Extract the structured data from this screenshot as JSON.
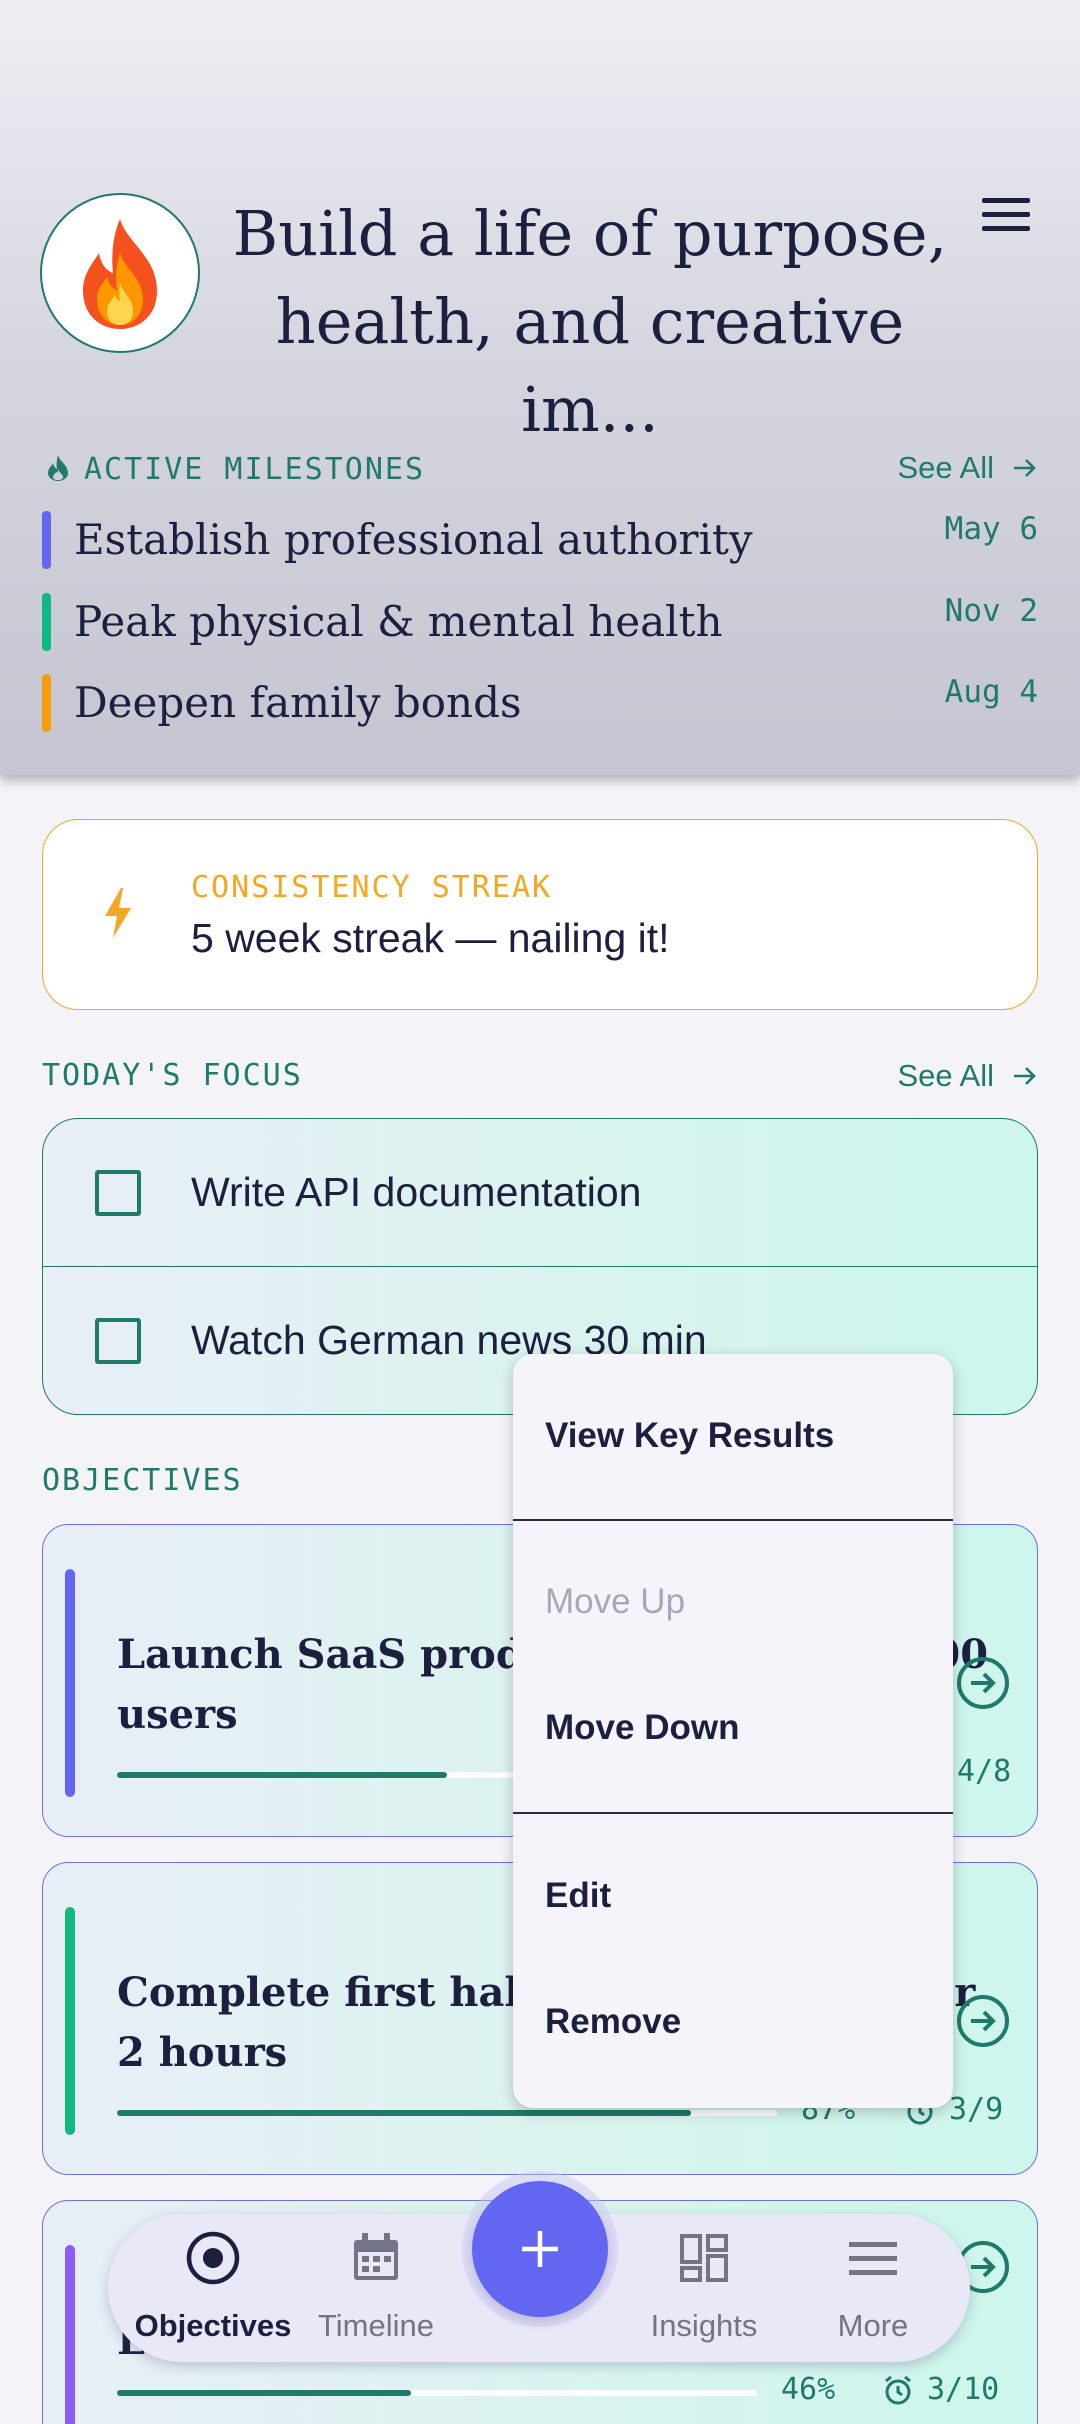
{
  "header": {
    "vision_title": "Build a life of purpose, health, and creative im...",
    "avatar_icon": "flame-emoji-icon",
    "menu_icon": "hamburger-menu-icon"
  },
  "milestones": {
    "label": "ACTIVE MILESTONES",
    "see_all": "See All",
    "items": [
      {
        "name": "Establish professional authority",
        "date": "May 6",
        "color": "#6366f1"
      },
      {
        "name": "Peak physical & mental health",
        "date": "Nov 2",
        "color": "#10b981"
      },
      {
        "name": "Deepen family bonds",
        "date": "Aug 4",
        "color": "#f59e0b"
      }
    ]
  },
  "streak": {
    "label": "CONSISTENCY STREAK",
    "text": "5 week streak — nailing it!",
    "icon": "lightning-bolt-icon"
  },
  "focus": {
    "label": "TODAY'S FOCUS",
    "see_all": "See All",
    "items": [
      {
        "text": "Write API documentation",
        "checked": false
      },
      {
        "text": "Watch German news 30 min",
        "checked": false
      }
    ]
  },
  "objectives": {
    "label": "OBJECTIVES",
    "items": [
      {
        "title": "Launch SaaS product & reach first 100 users",
        "progress": 0.5,
        "key_results": "4/8",
        "color": "#6366f1"
      },
      {
        "title": "Complete first half-marathon in under 2 hours",
        "progress": 0.87,
        "progress_label": "87%",
        "key_results": "3/9",
        "color": "#10b981"
      },
      {
        "title": "Learn conversational German",
        "progress": 0.46,
        "progress_label": "46%",
        "key_results": "3/10",
        "color": "#8b5cf6"
      }
    ]
  },
  "context_menu": {
    "view_key_results": "View Key Results",
    "move_up": "Move Up",
    "move_down": "Move Down",
    "edit": "Edit",
    "remove": "Remove"
  },
  "bottom_nav": {
    "objectives": "Objectives",
    "timeline": "Timeline",
    "insights": "Insights",
    "more": "More",
    "fab_icon": "plus-icon"
  },
  "colors": {
    "accent": "#1f7a6a",
    "primary": "#6366f1",
    "streak": "#f5a623",
    "text": "#1d1f3f"
  }
}
